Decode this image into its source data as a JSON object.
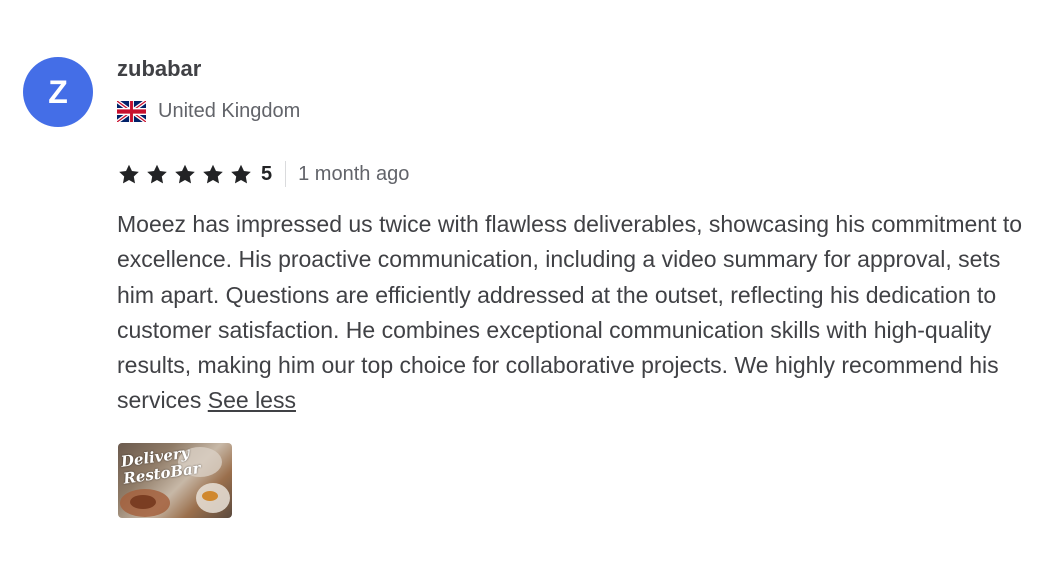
{
  "reviewer": {
    "avatar_initial": "Z",
    "username": "zubabar",
    "country": "United Kingdom",
    "flag_icon": "uk-flag-icon"
  },
  "rating": {
    "stars": 5,
    "score_label": "5",
    "time_ago": "1 month ago"
  },
  "review": {
    "text": "Moeez has impressed us twice with flawless deliverables, showcasing his commitment to excellence. His proactive communication, including a video summary for approval, sets him apart. Questions are efficiently addressed at the outset, reflecting his dedication to customer satisfaction. He combines exceptional communication skills with high-quality results, making him our top choice for collaborative projects. We highly recommend his services",
    "toggle_label": "See less"
  },
  "attachment": {
    "logo_text": "Delivery RestoBar"
  },
  "colors": {
    "avatar": "#446ee7",
    "text": "#404145",
    "muted": "#62646a",
    "star": "#222325"
  }
}
